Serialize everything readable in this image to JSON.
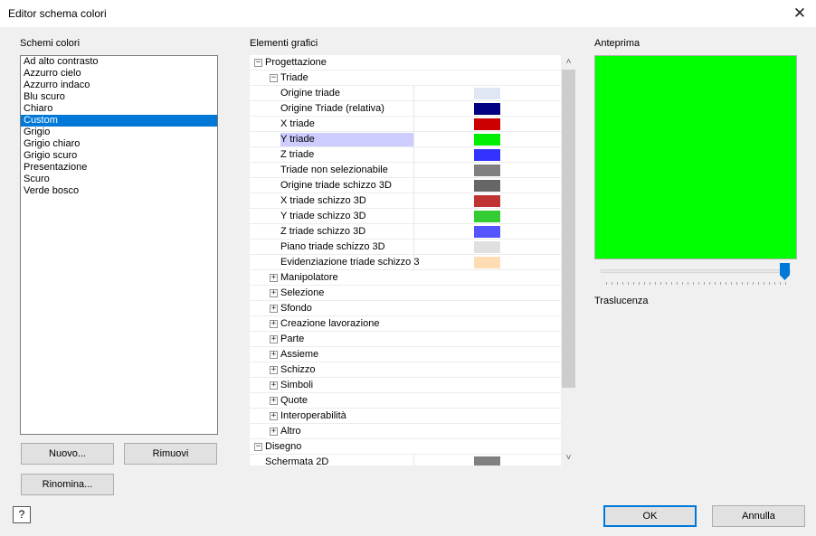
{
  "window": {
    "title": "Editor schema colori",
    "close_glyph": "✕"
  },
  "schemes": {
    "label": "Schemi colori",
    "items": [
      "Ad alto contrasto",
      "Azzurro cielo",
      "Azzurro indaco",
      "Blu scuro",
      "Chiaro",
      "Custom",
      "Grigio",
      "Grigio chiaro",
      "Grigio scuro",
      "Presentazione",
      "Scuro",
      "Verde bosco"
    ],
    "selected": "Custom"
  },
  "buttons": {
    "new": "Nuovo...",
    "remove": "Rimuovi",
    "rename": "Rinomina...",
    "ok": "OK",
    "cancel": "Annulla",
    "help_glyph": "?"
  },
  "elements": {
    "label": "Elementi grafici",
    "rows": [
      {
        "label": "Progettazione",
        "level": 0,
        "toggle": "minus"
      },
      {
        "label": "Triade",
        "level": 1,
        "toggle": "minus"
      },
      {
        "label": "Origine triade",
        "level": 2,
        "color": "#dfe7f5"
      },
      {
        "label": "Origine Triade (relativa)",
        "level": 2,
        "color": "#000080"
      },
      {
        "label": "X triade",
        "level": 2,
        "color": "#cc0000"
      },
      {
        "label": "Y triade",
        "level": 2,
        "color": "#00ee00",
        "highlight": true
      },
      {
        "label": "Z triade",
        "level": 2,
        "color": "#3333ff"
      },
      {
        "label": "Triade non selezionabile",
        "level": 2,
        "color": "#808080"
      },
      {
        "label": "Origine triade schizzo 3D",
        "level": 2,
        "color": "#666666"
      },
      {
        "label": "X triade schizzo 3D",
        "level": 2,
        "color": "#c03333"
      },
      {
        "label": "Y triade schizzo 3D",
        "level": 2,
        "color": "#33cc33"
      },
      {
        "label": "Z triade schizzo 3D",
        "level": 2,
        "color": "#5555ff"
      },
      {
        "label": "Piano triade schizzo 3D",
        "level": 2,
        "color": "#e0e0e0"
      },
      {
        "label": "Evidenziazione triade schizzo 3",
        "level": 2,
        "color": "#ffdcb4"
      },
      {
        "label": "Manipolatore",
        "level": 1,
        "toggle": "plus"
      },
      {
        "label": "Selezione",
        "level": 1,
        "toggle": "plus"
      },
      {
        "label": "Sfondo",
        "level": 1,
        "toggle": "plus"
      },
      {
        "label": "Creazione lavorazione",
        "level": 1,
        "toggle": "plus"
      },
      {
        "label": "Parte",
        "level": 1,
        "toggle": "plus"
      },
      {
        "label": "Assieme",
        "level": 1,
        "toggle": "plus"
      },
      {
        "label": "Schizzo",
        "level": 1,
        "toggle": "plus"
      },
      {
        "label": "Simboli",
        "level": 1,
        "toggle": "plus"
      },
      {
        "label": "Quote",
        "level": 1,
        "toggle": "plus"
      },
      {
        "label": "Interoperabilità",
        "level": 1,
        "toggle": "plus"
      },
      {
        "label": "Altro",
        "level": 1,
        "toggle": "plus"
      },
      {
        "label": "Disegno",
        "level": 0,
        "toggle": "minus"
      },
      {
        "label": "Schermata 2D",
        "level": 0.5,
        "color": "#808080"
      }
    ],
    "scroll_up_glyph": "˄",
    "scroll_down_glyph": "˅"
  },
  "preview": {
    "label": "Anteprima",
    "color": "#00ff00"
  },
  "translucency": {
    "label": "Traslucenza",
    "value": 1.0
  }
}
